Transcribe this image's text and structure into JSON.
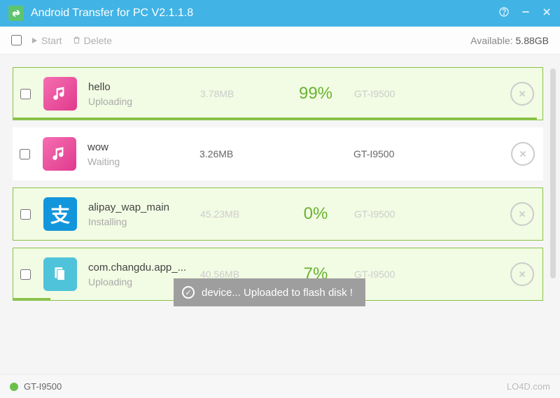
{
  "titlebar": {
    "title": "Android Transfer for PC V2.1.1.8"
  },
  "toolbar": {
    "start_label": "Start",
    "delete_label": "Delete",
    "available_label": "Available:",
    "available_value": "5.88GB"
  },
  "rows": [
    {
      "name": "hello",
      "status": "Uploading",
      "size": "3.78MB",
      "percent": "99%",
      "device": "GT-I9500",
      "active": true,
      "icon": "pink-music",
      "progress": 99
    },
    {
      "name": "wow",
      "status": "Waiting",
      "size": "3.26MB",
      "percent": "",
      "device": "GT-I9500",
      "active": false,
      "icon": "pink-music",
      "progress": 0
    },
    {
      "name": "alipay_wap_main",
      "status": "Installing",
      "size": "45.23MB",
      "percent": "0%",
      "device": "GT-I9500",
      "active": true,
      "icon": "alipay",
      "progress": 0
    },
    {
      "name": "com.changdu.app_...",
      "status": "Uploading",
      "size": "40.56MB",
      "percent": "7%",
      "device": "GT-I9500",
      "active": true,
      "icon": "doc-teal",
      "progress": 7
    }
  ],
  "toast": {
    "text": "device... Uploaded to flash disk !"
  },
  "statusbar": {
    "device": "GT-I9500",
    "brand": "LO4D.com"
  }
}
